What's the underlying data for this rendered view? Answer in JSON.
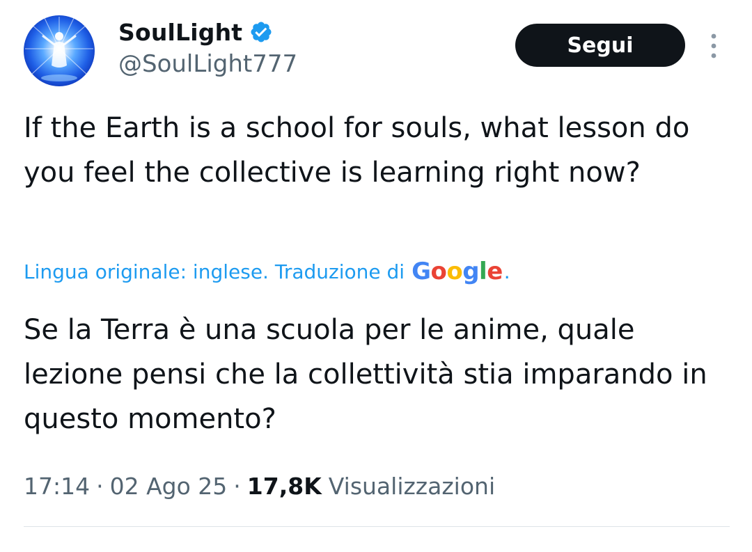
{
  "account": {
    "display_name": "SoulLight",
    "handle": "@SoulLight777",
    "verified": true,
    "verified_color": "#1d9bf0",
    "avatar_icon": "glowing-figure-avatar"
  },
  "actions": {
    "follow_label": "Segui",
    "more_icon": "vertical-ellipsis-icon"
  },
  "tweet": {
    "text": "If the Earth is a school for souls, what lesson do you feel the collective is learning right now?"
  },
  "translation": {
    "label": "Lingua originale: inglese. Traduzione di",
    "provider": "Google",
    "trailing": ".",
    "text": "Se la Terra è una scuola per le anime, quale lezione pensi che la collettività stia imparando in questo momento?"
  },
  "meta": {
    "time": "17:14",
    "date": "02 Ago 25",
    "separator": "·",
    "views_count": "17,8K",
    "views_label": "Visualizzazioni"
  },
  "colors": {
    "text": "#0f1419",
    "secondary": "#536471",
    "link": "#1d9bf0",
    "button_bg": "#0f1419"
  }
}
